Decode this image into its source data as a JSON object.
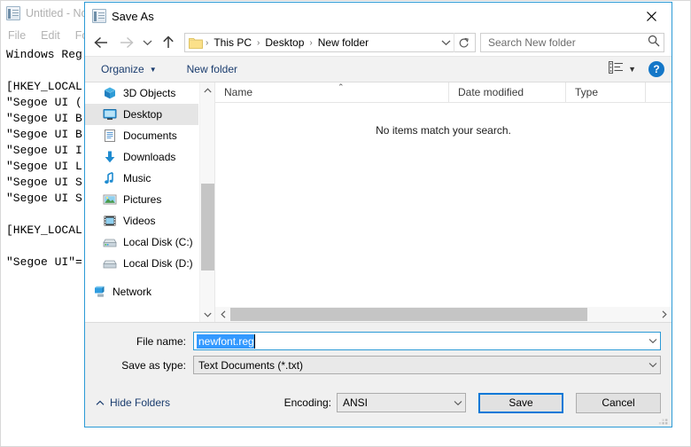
{
  "notepad": {
    "title": "Untitled - Notepad",
    "icon": "notepad-icon",
    "menu": [
      "File",
      "Edit",
      "Format"
    ],
    "text": "Windows Reg\n\n[HKEY_LOCAL\n\"Segoe UI (\n\"Segoe UI B\n\"Segoe UI B\n\"Segoe UI I\n\"Segoe UI L\n\"Segoe UI S\n\"Segoe UI S\n\n[HKEY_LOCAL\n\n\"Segoe UI\"="
  },
  "dialog": {
    "title": "Save As",
    "icon": "notepad-icon",
    "close_label": "✕",
    "nav": {
      "back_icon": "arrow-left-icon",
      "forward_icon": "arrow-right-icon",
      "recent_icon": "chevron-down-icon",
      "up_icon": "arrow-up-icon"
    },
    "breadcrumb": {
      "folder_icon": "folder-icon",
      "items": [
        "This PC",
        "Desktop",
        "New folder"
      ],
      "separator": "›",
      "dropdown_icon": "chevron-down-icon",
      "refresh_icon": "refresh-icon"
    },
    "search": {
      "placeholder": "Search New folder",
      "icon": "search-icon"
    },
    "toolbar": {
      "organize": "Organize",
      "organize_arrow": "▼",
      "new_folder": "New folder",
      "view_icon": "view-list-icon",
      "view_arrow": "▼",
      "help_icon": "help-icon",
      "help_label": "?"
    },
    "sidebar": {
      "items": [
        {
          "label": "3D Objects",
          "icon": "3d-objects-icon",
          "selected": false
        },
        {
          "label": "Desktop",
          "icon": "desktop-icon",
          "selected": true
        },
        {
          "label": "Documents",
          "icon": "documents-icon",
          "selected": false
        },
        {
          "label": "Downloads",
          "icon": "downloads-icon",
          "selected": false
        },
        {
          "label": "Music",
          "icon": "music-icon",
          "selected": false
        },
        {
          "label": "Pictures",
          "icon": "pictures-icon",
          "selected": false
        },
        {
          "label": "Videos",
          "icon": "videos-icon",
          "selected": false
        },
        {
          "label": "Local Disk (C:)",
          "icon": "local-disk-c-icon",
          "selected": false
        },
        {
          "label": "Local Disk (D:)",
          "icon": "local-disk-d-icon",
          "selected": false
        },
        {
          "label": "Network",
          "icon": "network-icon",
          "selected": false
        }
      ]
    },
    "filelist": {
      "columns": [
        "Name",
        "Date modified",
        "Type"
      ],
      "sort_indicator": "⌃",
      "rows": [],
      "empty_message": "No items match your search."
    },
    "form": {
      "filename_label": "File name:",
      "filename_value": "newfont.reg",
      "filetype_label": "Save as type:",
      "filetype_value": "Text Documents (*.txt)",
      "hide_folders_label": "Hide Folders",
      "hide_folders_icon": "chevron-up-icon",
      "encoding_label": "Encoding:",
      "encoding_value": "ANSI",
      "save_label": "Save",
      "cancel_label": "Cancel"
    }
  },
  "colors": {
    "accent": "#0078d7",
    "dialog_border": "#2b9ad6",
    "selection": "#3399ff",
    "link_text": "#1a3c6e",
    "toolbar_bg": "#f2f2f2",
    "form_bg": "#f0f0f0",
    "sidebar_selected": "#e5e5e5"
  }
}
